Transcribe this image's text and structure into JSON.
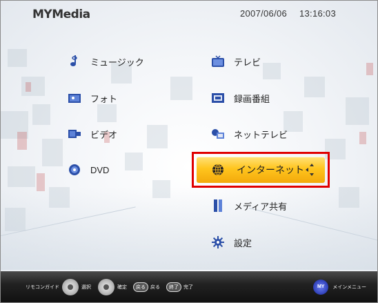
{
  "header": {
    "logo": "MYMedia",
    "date": "2007/06/06",
    "time": "13:16:03"
  },
  "menu": {
    "left": [
      {
        "label": "ミュージック",
        "icon": "music-note-icon"
      },
      {
        "label": "フォト",
        "icon": "photo-icon"
      },
      {
        "label": "ビデオ",
        "icon": "video-icon"
      },
      {
        "label": "DVD",
        "icon": "disc-icon"
      }
    ],
    "right": [
      {
        "label": "テレビ",
        "icon": "tv-icon"
      },
      {
        "label": "録画番組",
        "icon": "recorded-program-icon"
      },
      {
        "label": "ネットテレビ",
        "icon": "net-tv-icon"
      },
      {
        "label": "インターネット",
        "icon": "globe-icon",
        "selected": true
      },
      {
        "label": "メディア共有",
        "icon": "media-share-icon"
      },
      {
        "label": "設定",
        "icon": "settings-gear-icon"
      }
    ]
  },
  "bottom_bar": {
    "remote_guide": "リモコンガイド",
    "select": "選択",
    "confirm": "確定",
    "back_key": "戻る",
    "back": "戻る",
    "finish_key": "終了",
    "finish": "完了",
    "my_key": "MY",
    "main_menu": "メインメニュー"
  },
  "colors": {
    "selected_gradient_top": "#ffe27a",
    "selected_gradient_bottom": "#f3a90b",
    "highlight_frame": "#e00000",
    "bar_background": "#1a1a1a"
  }
}
